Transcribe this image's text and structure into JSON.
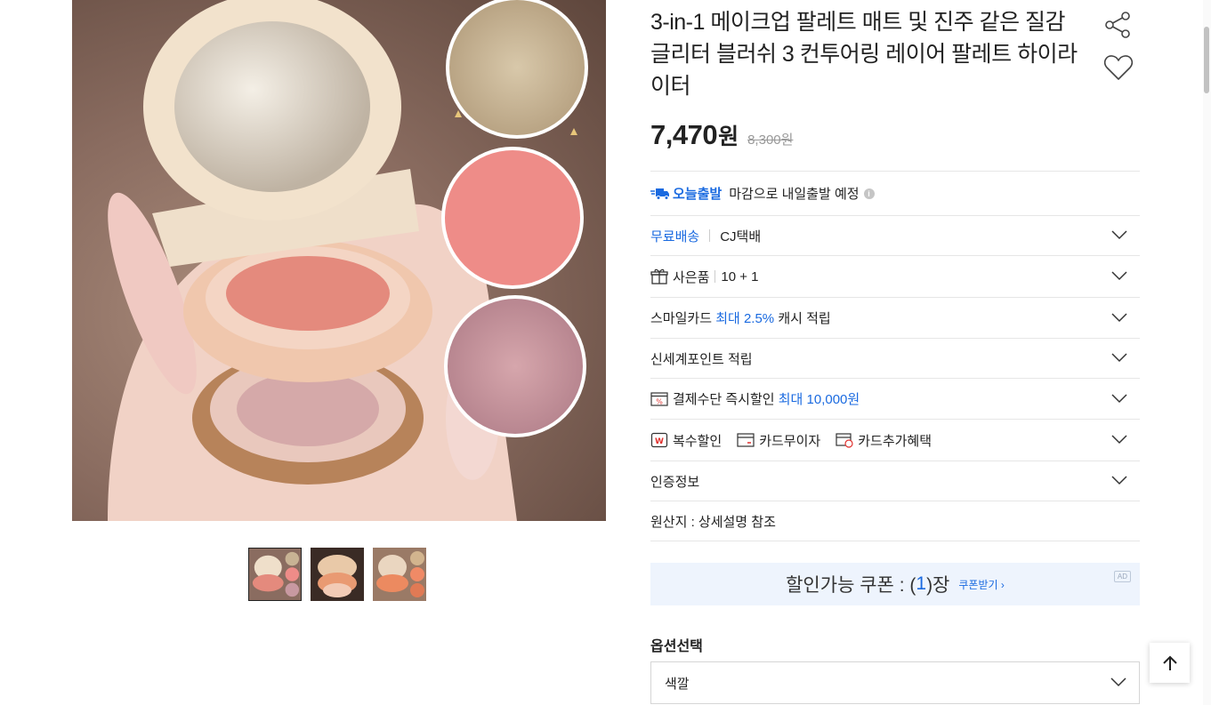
{
  "product": {
    "title": "3-in-1 메이크업 팔레트 매트 및 진주 같은 질감 글리터 블러쉬 3 컨투어링 레이어 팔레트 하이라이터",
    "price": "7,470",
    "price_unit": "원",
    "original_price": "8,300원"
  },
  "delivery": {
    "badge": "오늘출발",
    "note": "마감으로 내일출발 예정",
    "info_glyph": "i"
  },
  "shipping": {
    "label": "무료배송",
    "carrier": "CJ택배"
  },
  "gift": {
    "label": "사은품",
    "value": "10 + 1"
  },
  "smile_card": {
    "prefix": "스마일카드",
    "highlight": "최대 2.5%",
    "suffix": "캐시 적립"
  },
  "points": {
    "label": "신세계포인트 적립"
  },
  "payment": {
    "label": "결제수단 즉시할인",
    "highlight": "최대 10,000원"
  },
  "benefits": [
    "복수할인",
    "카드무이자",
    "카드추가혜택"
  ],
  "certification": {
    "label": "인증정보"
  },
  "origin": {
    "label": "원산지 : 상세설명 참조"
  },
  "coupon": {
    "prefix": "할인가능 쿠폰 : (",
    "count": "1",
    "suffix": ")장",
    "link": "쿠폰받기 ›",
    "ad": "AD"
  },
  "option": {
    "label": "옵션선택",
    "selected": "색깔"
  },
  "icons": {
    "share": "share-icon",
    "wishlist": "heart-icon",
    "truck": "truck-icon",
    "gift": "gift-icon",
    "percent": "percent-card-icon",
    "scroll_top": "arrow-up-icon"
  },
  "colors": {
    "accent": "#1a6ae0",
    "coupon_bg": "#eef4fd"
  }
}
